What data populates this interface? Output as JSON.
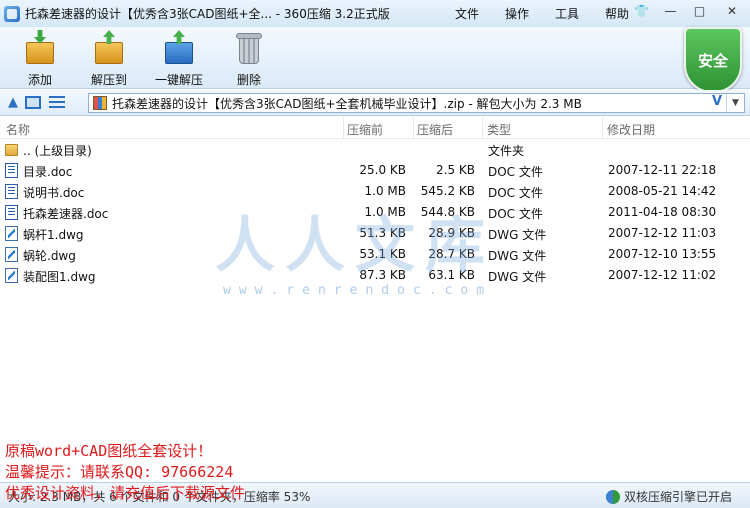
{
  "window": {
    "title": "托森差速器的设计【优秀含3张CAD图纸+全... - 360压缩 3.2正式版",
    "menu": [
      "文件",
      "操作",
      "工具",
      "帮助"
    ],
    "controls": {
      "skin": "👕",
      "minimize": "—",
      "maximize": "□",
      "close": "✕"
    }
  },
  "toolbar": {
    "add_label": "添加",
    "extract_label": "解压到",
    "oneclick_label": "一键解压",
    "delete_label": "删除",
    "security_badge": "安全"
  },
  "address": {
    "path": "托森差速器的设计【优秀含3张CAD图纸+全套机械毕业设计】.zip - 解包大小为 2.3 MB",
    "v_label": "V"
  },
  "columns": {
    "name": "名称",
    "packed": "压缩前",
    "size": "压缩后",
    "type": "类型",
    "date": "修改日期"
  },
  "files": [
    {
      "name": ".. (上级目录)",
      "packed": "",
      "size": "",
      "type": "文件夹",
      "date": "",
      "icon": "folder-icon"
    },
    {
      "name": "目录.doc",
      "packed": "25.0 KB",
      "size": "2.5 KB",
      "type": "DOC 文件",
      "date": "2007-12-11 22:18",
      "icon": "doc-icon"
    },
    {
      "name": "说明书.doc",
      "packed": "1.0 MB",
      "size": "545.2 KB",
      "type": "DOC 文件",
      "date": "2008-05-21 14:42",
      "icon": "doc-icon"
    },
    {
      "name": "托森差速器.doc",
      "packed": "1.0 MB",
      "size": "544.8 KB",
      "type": "DOC 文件",
      "date": "2011-04-18 08:30",
      "icon": "doc-icon"
    },
    {
      "name": "蜗杆1.dwg",
      "packed": "51.3 KB",
      "size": "28.9 KB",
      "type": "DWG 文件",
      "date": "2007-12-12 11:03",
      "icon": "dwg-icon"
    },
    {
      "name": "蜗轮.dwg",
      "packed": "53.1 KB",
      "size": "28.7 KB",
      "type": "DWG 文件",
      "date": "2007-12-10 13:55",
      "icon": "dwg-icon"
    },
    {
      "name": "装配图1.dwg",
      "packed": "87.3 KB",
      "size": "63.1 KB",
      "type": "DWG 文件",
      "date": "2007-12-12 11:02",
      "icon": "dwg-icon"
    }
  ],
  "watermark": {
    "text": "人人文库",
    "url": "www.renrendoc.com"
  },
  "status": {
    "left": "大小: 2.3 MB，共 6 个文件和 0 个文件夹，压缩率 53%",
    "right": "双核压缩引擎已开启"
  },
  "overlay": {
    "line1": "原稿word+CAD图纸全套设计！",
    "line2": "温馨提示：请联系QQ: 97666224",
    "line3": "优秀设计资料，请充值后下载源文件"
  }
}
